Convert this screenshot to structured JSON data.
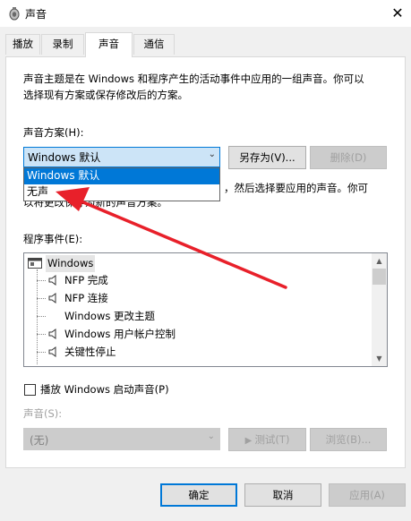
{
  "window": {
    "title": "声音",
    "close_label": "✕"
  },
  "tabs": [
    {
      "label": "播放"
    },
    {
      "label": "录制"
    },
    {
      "label": "声音",
      "active": true
    },
    {
      "label": "通信"
    }
  ],
  "description": {
    "line1": "声音主题是在 Windows 和程序产生的活动事件中应用的一组声音。你可以",
    "line2": "选择现有方案或保存修改后的方案。"
  },
  "scheme": {
    "label": "声音方案(H):",
    "selected": "Windows 默认",
    "options": [
      "Windows 默认",
      "无声"
    ],
    "save_as_button": "另存为(V)...",
    "delete_button": "删除(D)"
  },
  "hint": {
    "line1_fragment": "，然后选择要应用的声音。你可",
    "line2_fragment": "以将更改保存为新的声音方案。"
  },
  "events": {
    "label": "程序事件(E):",
    "items": [
      {
        "label": "Windows",
        "level": 0
      },
      {
        "label": "NFP 完成",
        "level": 1,
        "has_sound": true
      },
      {
        "label": "NFP 连接",
        "level": 1,
        "has_sound": true
      },
      {
        "label": "Windows 更改主题",
        "level": 1,
        "has_sound": false
      },
      {
        "label": "Windows 用户帐户控制",
        "level": 1,
        "has_sound": true
      },
      {
        "label": "关键性停止",
        "level": 1,
        "has_sound": true
      }
    ]
  },
  "startup": {
    "label": "播放 Windows 启动声音(P)",
    "checked": false
  },
  "sound": {
    "label": "声音(S):",
    "value": "(无)",
    "test_button": "测试(T)",
    "browse_button": "浏览(B)..."
  },
  "footer": {
    "ok": "确定",
    "cancel": "取消",
    "apply": "应用(A)"
  },
  "colors": {
    "accent": "#0078d7",
    "annotation_arrow": "#e8202a"
  }
}
